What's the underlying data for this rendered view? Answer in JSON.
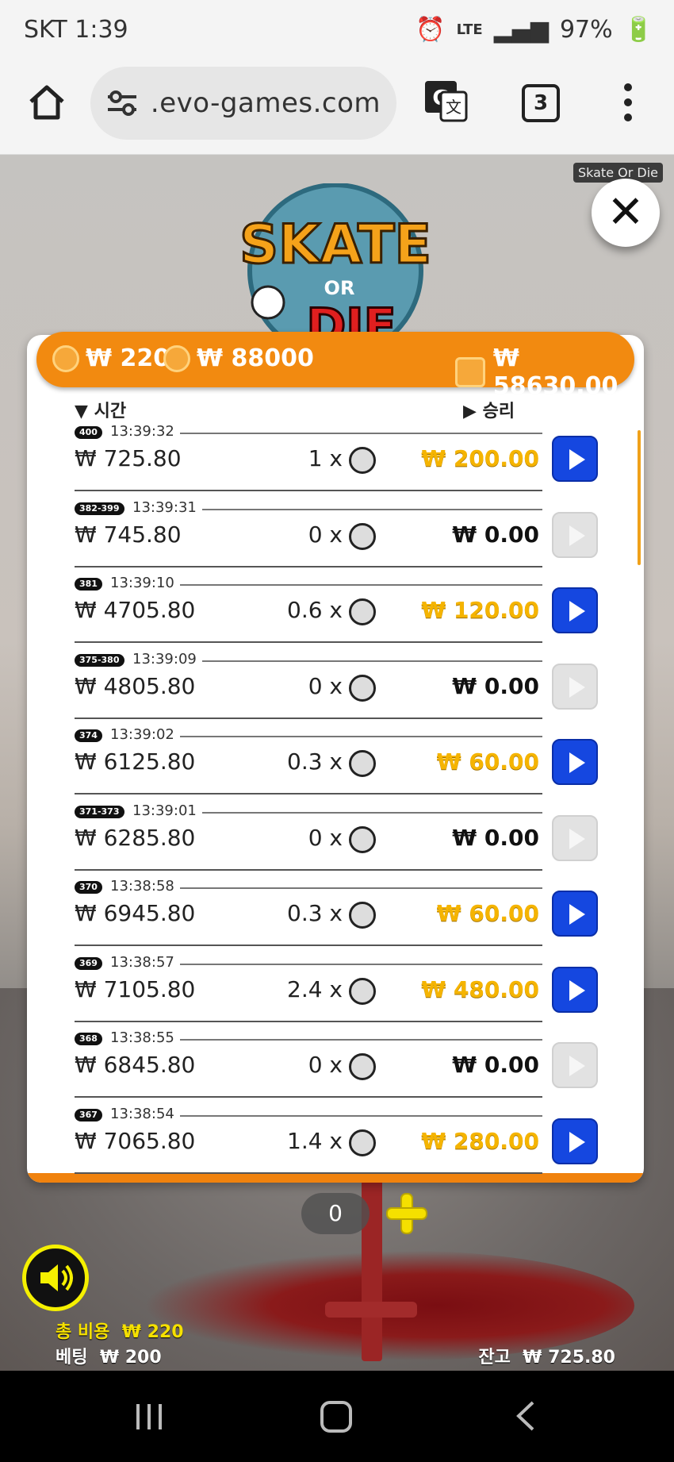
{
  "status_bar": {
    "carrier_time": "SKT 1:39",
    "network": "LTE",
    "battery": "97%"
  },
  "browser": {
    "url": " .evo-games.com",
    "tab_count": "3"
  },
  "game": {
    "tag": "Skate Or Die",
    "logo_text": "Skate Or Die",
    "summary": {
      "coin_bet": "₩ 220",
      "coin_total": "₩ 88000",
      "wallet_balance": "₩ 58630.00"
    },
    "history": {
      "headers": {
        "time": "시간",
        "win": "승리"
      },
      "rows": [
        {
          "id": "400",
          "time": "13:39:32",
          "balance": "₩ 725.80",
          "multiplier": "1 x",
          "win": "₩ 200.00",
          "status": "win"
        },
        {
          "id": "382-399",
          "time": "13:39:31",
          "balance": "₩ 745.80",
          "multiplier": "0 x",
          "win": "₩ 0.00",
          "status": "zero"
        },
        {
          "id": "381",
          "time": "13:39:10",
          "balance": "₩ 4705.80",
          "multiplier": "0.6 x",
          "win": "₩ 120.00",
          "status": "win"
        },
        {
          "id": "375-380",
          "time": "13:39:09",
          "balance": "₩ 4805.80",
          "multiplier": "0 x",
          "win": "₩ 0.00",
          "status": "zero"
        },
        {
          "id": "374",
          "time": "13:39:02",
          "balance": "₩ 6125.80",
          "multiplier": "0.3 x",
          "win": "₩ 60.00",
          "status": "win"
        },
        {
          "id": "371-373",
          "time": "13:39:01",
          "balance": "₩ 6285.80",
          "multiplier": "0 x",
          "win": "₩ 0.00",
          "status": "zero"
        },
        {
          "id": "370",
          "time": "13:38:58",
          "balance": "₩ 6945.80",
          "multiplier": "0.3 x",
          "win": "₩ 60.00",
          "status": "win"
        },
        {
          "id": "369",
          "time": "13:38:57",
          "balance": "₩ 7105.80",
          "multiplier": "2.4 x",
          "win": "₩ 480.00",
          "status": "win"
        },
        {
          "id": "368",
          "time": "13:38:55",
          "balance": "₩ 6845.80",
          "multiplier": "0 x",
          "win": "₩ 0.00",
          "status": "zero"
        },
        {
          "id": "367",
          "time": "13:38:54",
          "balance": "₩ 7065.80",
          "multiplier": "1.4 x",
          "win": "₩ 280.00",
          "status": "win"
        }
      ]
    },
    "controls": {
      "bet_count": "0",
      "total_cost_label": "총 비용",
      "total_cost_value": "₩ 220",
      "bet_label": "베팅",
      "bet_value": "₩ 200",
      "balance_label": "잔고",
      "balance_value": "₩ 725.80"
    }
  },
  "colors": {
    "accent_orange": "#f28a10",
    "win_gold": "#f5b400",
    "play_blue": "#1547e0"
  }
}
